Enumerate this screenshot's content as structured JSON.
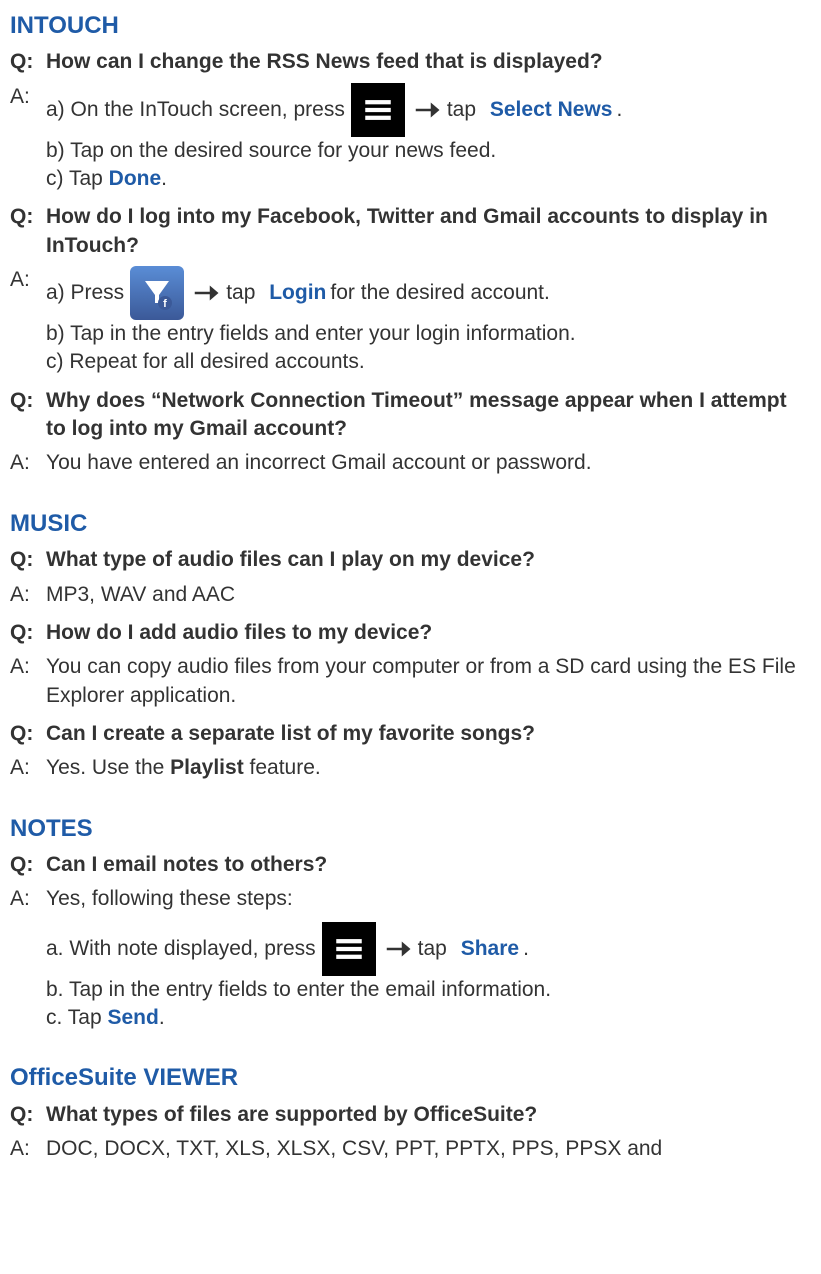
{
  "sections": {
    "intouch": {
      "title": "INTOUCH",
      "q1": "How can I change the RSS News feed that is displayed?",
      "a1_a_pre": "a) On the InTouch screen, press",
      "a1_a_tap": "tap",
      "a1_a_link": "Select News",
      "a1_a_post": ".",
      "a1_b": "b) Tap on the desired source for your news feed.",
      "a1_c_pre": "c) Tap ",
      "a1_c_link": "Done",
      "a1_c_post": ".",
      "q2": "How do I log into my Facebook, Twitter and Gmail accounts to display in InTouch?",
      "a2_a_pre": "a) Press",
      "a2_a_tap": "tap",
      "a2_a_link": "Login",
      "a2_a_post": " for the desired account.",
      "a2_b": "b) Tap in the entry fields and enter your login information.",
      "a2_c": "c) Repeat for all desired accounts.",
      "q3": "Why does “Network Connection Timeout” message appear when I attempt to log into my Gmail account?",
      "a3": " You have entered an incorrect Gmail account or password."
    },
    "music": {
      "title": "MUSIC",
      "q1": "What type of audio files can I play on my device?",
      "a1": "MP3, WAV and AAC",
      "q2": "How do I add audio files to my device?",
      "a2": "You can copy audio files from your computer or from a SD card using the ES File Explorer application.",
      "q3": "Can I create a separate list of my favorite songs?",
      "a3_pre": "Yes. Use the ",
      "a3_bold": "Playlist",
      "a3_post": " feature."
    },
    "notes": {
      "title": "NOTES",
      "q1": "Can I email notes to others?",
      "a1_intro": "Yes, following these steps:",
      "a1_a_pre": "a. With note displayed, press",
      "a1_a_tap": "tap",
      "a1_a_link": "Share",
      "a1_a_post": ".",
      "a1_b": "b. Tap in the entry fields to enter the email information.",
      "a1_c_pre": "c. Tap ",
      "a1_c_link": "Send",
      "a1_c_post": "."
    },
    "office": {
      "title": "OfficeSuite VIEWER",
      "q1": "What types of files are supported by OfficeSuite?",
      "a1": "DOC, DOCX, TXT, XLS, XLSX, CSV, PPT, PPTX, PPS, PPSX and"
    }
  },
  "labels": {
    "q": "Q:",
    "a": "A:"
  }
}
